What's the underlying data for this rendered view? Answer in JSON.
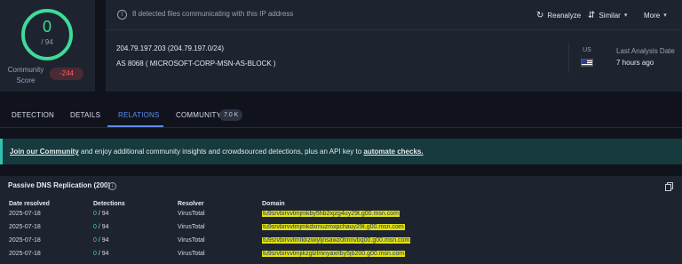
{
  "score": {
    "detections": "0",
    "total": "/ 94",
    "community_label": "Community Score",
    "community_value": "-244"
  },
  "header": {
    "banner": "8 detected files communicating with this IP address",
    "reanalyze": "Reanalyze",
    "similar": "Similar",
    "more": "More",
    "ip": "204.79.197.203  (204.79.197.0/24)",
    "as": "AS 8068  ( MICROSOFT-CORP-MSN-AS-BLOCK )",
    "country": "US",
    "last_label": "Last Analysis Date",
    "last_value": "7 hours ago"
  },
  "tabs": {
    "detection": "DETECTION",
    "details": "DETAILS",
    "relations": "RELATIONS",
    "community": "COMMUNITY",
    "community_count": "7.0 K"
  },
  "community_banner": {
    "link1": "Join our Community",
    "middle": " and enjoy additional community insights and crowdsourced detections, plus an API key to ",
    "link2": "automate checks."
  },
  "dns": {
    "title": "Passive DNS Replication  (200)",
    "columns": {
      "date": "Date resolved",
      "detections": "Detections",
      "resolver": "Resolver",
      "domain": "Domain"
    },
    "rows": [
      {
        "date": "2025-07-18",
        "det_zero": "0",
        "det_total": " / 94",
        "resolver": "VirusTotal",
        "domain": "tu9srvbirvvtmjmkby5hb2xjzg4uy29t.g00.msn.com"
      },
      {
        "date": "2025-07-18",
        "det_zero": "0",
        "det_total": " / 94",
        "resolver": "VirusTotal",
        "domain": "tu9srvbirvvtmjmkdxmuzmxpchauy29t.g00.msn.com"
      },
      {
        "date": "2025-07-18",
        "det_zero": "0",
        "det_total": " / 94",
        "resolver": "VirusTotal",
        "domain": "tu9srvbirvvtmtkkzwiyljnsawz0lmnvbq00.g00.msn.com"
      },
      {
        "date": "2025-07-18",
        "det_zero": "0",
        "det_total": " / 94",
        "resolver": "VirusTotal",
        "domain": "tu9srvbirvvtmjikzglzlmnyaxrlby5jb200.g00.msn.com"
      }
    ]
  },
  "colors": {
    "accent": "#5d8cf2",
    "clean": "#3ddc97",
    "negative": "#ff5d6c",
    "highlight": "#e3e013"
  },
  "icons": [
    "info-icon",
    "refresh-icon",
    "similar-icon",
    "chevron-down-icon",
    "copy-icon",
    "us-flag-icon"
  ]
}
